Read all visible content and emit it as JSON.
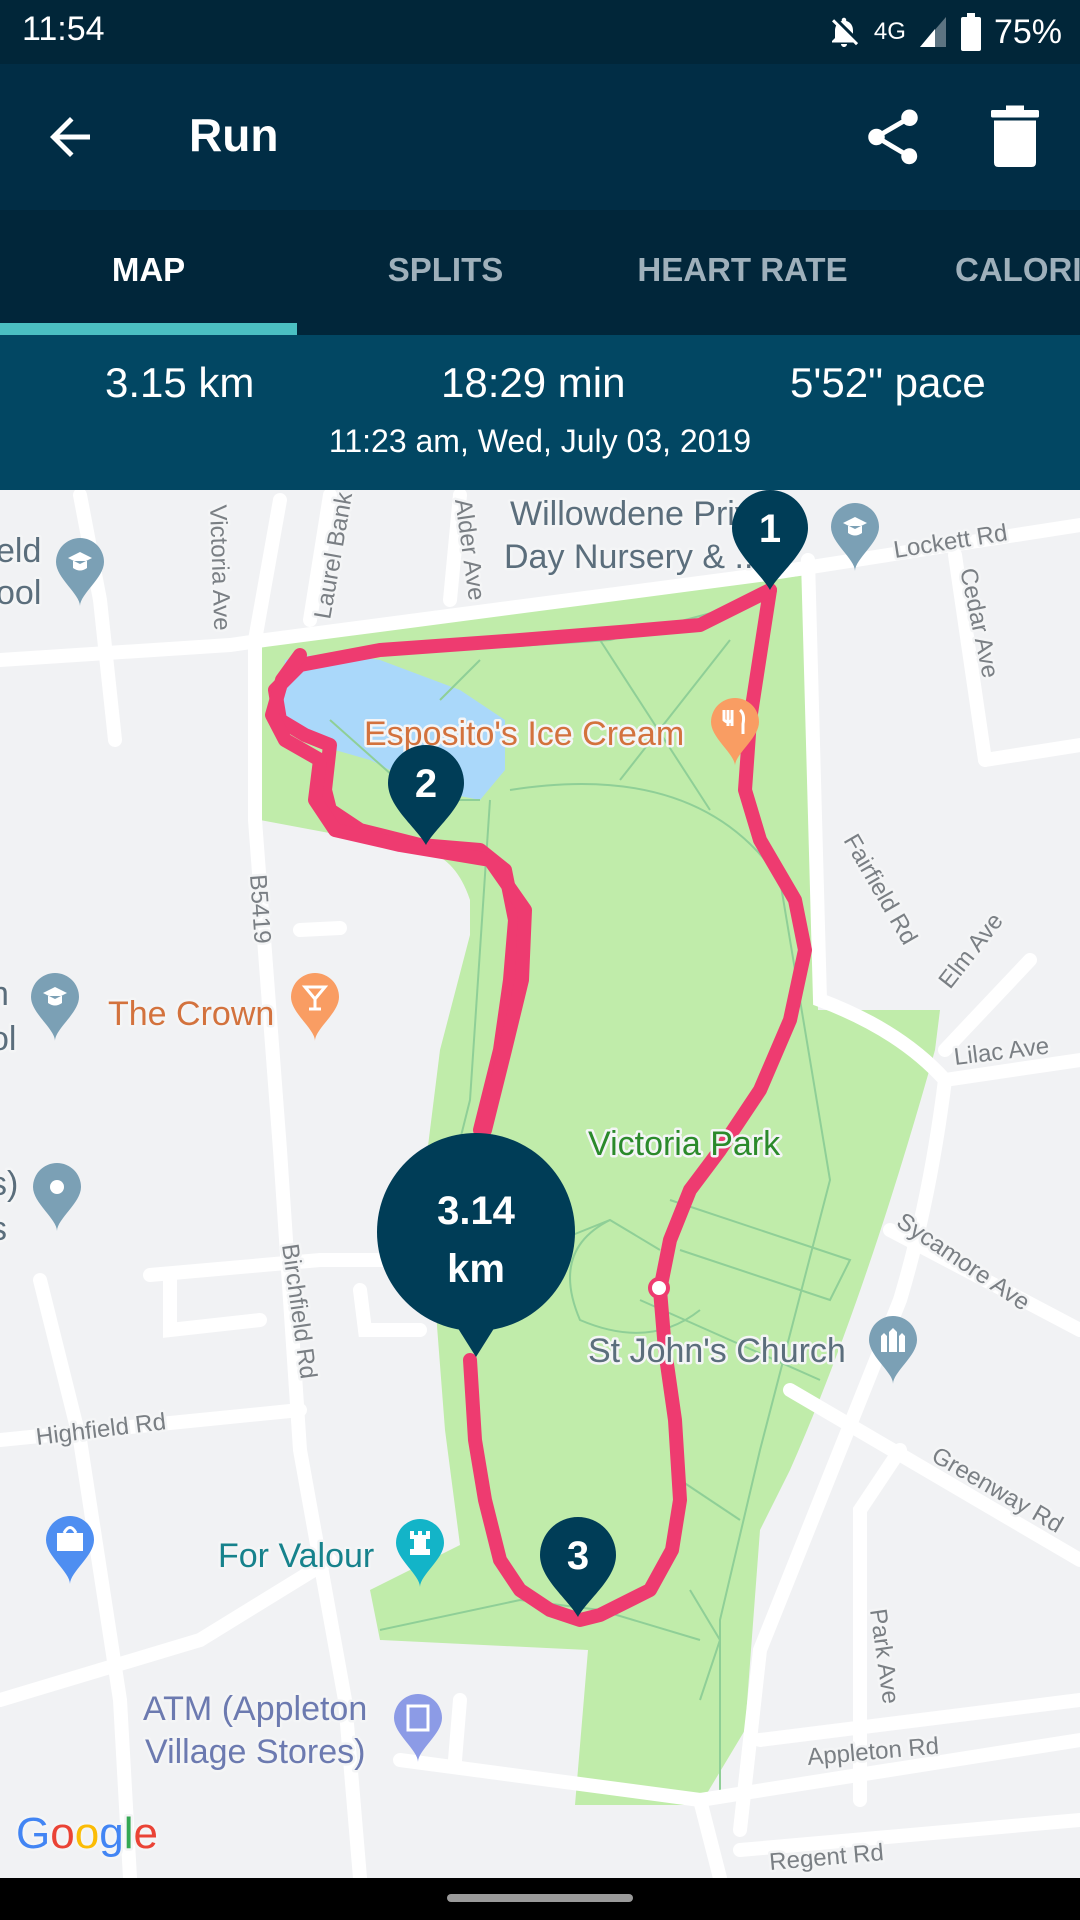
{
  "status_bar": {
    "time": "11:54",
    "icons": [
      "notifications-off-icon",
      "4g-icon",
      "signal-icon",
      "battery-icon"
    ],
    "network": "4G",
    "battery": "75%"
  },
  "app_bar": {
    "title": "Run",
    "back_icon": "arrow-back-icon",
    "share_icon": "share-icon",
    "delete_icon": "trash-icon"
  },
  "tabs": [
    {
      "label": "MAP",
      "active": true
    },
    {
      "label": "SPLITS",
      "active": false
    },
    {
      "label": "HEART RATE",
      "active": false
    },
    {
      "label": "CALORIES",
      "active": false
    }
  ],
  "summary": {
    "distance": "3.15 km",
    "duration": "18:29 min",
    "pace": "5'52\" pace",
    "datetime": "11:23 am, Wed, July 03, 2019"
  },
  "map": {
    "route_color": "#ee3b70",
    "marker_color": "#003d57",
    "km_markers": [
      "1",
      "2",
      "3"
    ],
    "current_marker": {
      "value": "3.14",
      "unit": "km"
    },
    "places": [
      {
        "name": "Willowdene Private",
        "line2": "Day Nursery & ...",
        "type": "school"
      },
      {
        "name": "Esposito's Ice Cream",
        "type": "restaurant"
      },
      {
        "name": "The Crown",
        "type": "bar"
      },
      {
        "name": "Victoria Park",
        "type": "park"
      },
      {
        "name": "St John's Church",
        "type": "church"
      },
      {
        "name": "For Valour",
        "type": "monument"
      },
      {
        "name": "ATM (Appleton",
        "line2": "Village Stores)",
        "type": "atm"
      },
      {
        "name": "eld",
        "line2": "ool",
        "type": "school"
      },
      {
        "name": "n",
        "line2": "ol",
        "type": "school"
      },
      {
        "name": "s)",
        "line2": "s",
        "type": "place"
      },
      {
        "name": "",
        "type": "shopping"
      }
    ],
    "streets": [
      "Victoria Ave",
      "Laurel Bank",
      "Alder Ave",
      "Lockett Rd",
      "Cedar Ave",
      "Fairfield Rd",
      "Elm Ave",
      "Lilac Ave",
      "B5419",
      "Birchfield Rd",
      "Sycamore Ave",
      "Highfield Rd",
      "Greenway Rd",
      "Park Ave",
      "Appleton Rd",
      "Regent Rd"
    ],
    "attribution": "Google"
  }
}
